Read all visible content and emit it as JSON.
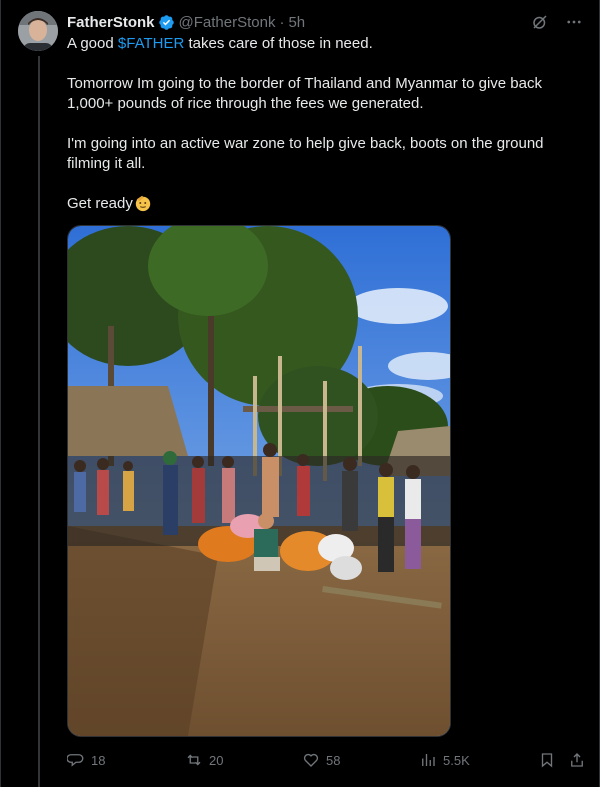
{
  "tweet": {
    "author_name": "FatherStonk",
    "author_handle": "@FatherStonk",
    "separator": "·",
    "time": "5h",
    "text": {
      "line1_pre": "A good ",
      "cashtag": "$FATHER",
      "line1_post": " takes care of those in need.",
      "para2": "Tomorrow Im going to the border of Thailand and Myanmar to give back 1,000+ pounds of rice through the fees we generated.",
      "para3": "I'm going into an active war zone to help give back, boots on the ground filming it all.",
      "para4": "Get ready"
    },
    "media": {
      "icon": "photo",
      "description_icon": "image"
    },
    "stats": {
      "replies": "18",
      "reposts": "20",
      "likes": "58",
      "views": "5.5K"
    }
  },
  "colors": {
    "background": "#000000",
    "text": "#e7e9ea",
    "muted": "#71767b",
    "accent": "#1d9bf0"
  },
  "icons": {
    "verified": "verified-badge-icon",
    "grok": "grok-icon",
    "more": "more-icon",
    "reply": "reply-icon",
    "repost": "repost-icon",
    "like": "heart-icon",
    "views": "views-icon",
    "bookmark": "bookmark-icon",
    "share": "share-icon",
    "emoji": "saluting-face-emoji"
  }
}
